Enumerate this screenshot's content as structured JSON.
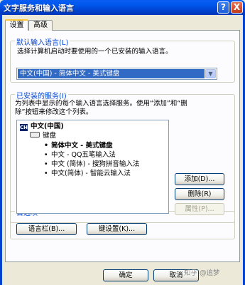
{
  "window": {
    "title": "文字服务和输入语言",
    "help_glyph": "?",
    "close_glyph": "X"
  },
  "tabs": [
    {
      "label": "设置",
      "active": true
    },
    {
      "label": "高级",
      "active": false
    }
  ],
  "default_language": {
    "legend": "默认输入语言(L)",
    "description": "选择计算机启动时要使用的一个已安装的输入语言。",
    "selected": "中文(中国) - 简体中文 - 美式键盘",
    "arrow_glyph": "▼"
  },
  "installed_services": {
    "legend": "已安装的服务(I)",
    "description_lines": [
      "为列表中显示的每个输入语言选择服务。使用“添加”和“删",
      "除”按钮来修改这个列表。"
    ],
    "tree": {
      "language_badge": "CH",
      "language": "中文(中国)",
      "category": "键盘",
      "items": [
        {
          "label": "简体中文 - 美式键盘",
          "bold": true
        },
        {
          "label": "中文 - QQ五笔输入法",
          "bold": false
        },
        {
          "label": "中文 (简体) - 搜狗拼音输入法",
          "bold": false
        },
        {
          "label": "中文(简体) - 智能云输入法",
          "bold": false
        }
      ]
    },
    "buttons": {
      "add": "添加(D)...",
      "remove": "删除(R)",
      "properties": "属性(P)..."
    }
  },
  "preferences": {
    "legend": "首选项",
    "language_bar": "语言栏(B)...",
    "key_settings": "键设置(K)..."
  },
  "footer": {
    "ok": "确定",
    "cancel": "取消",
    "watermark": "知乎 @追梦"
  },
  "colors": {
    "titlebar": "#0058EE",
    "legend_text": "#0046D5",
    "selection": "#316AC5",
    "dialog_bg": "#ECE9D8"
  }
}
